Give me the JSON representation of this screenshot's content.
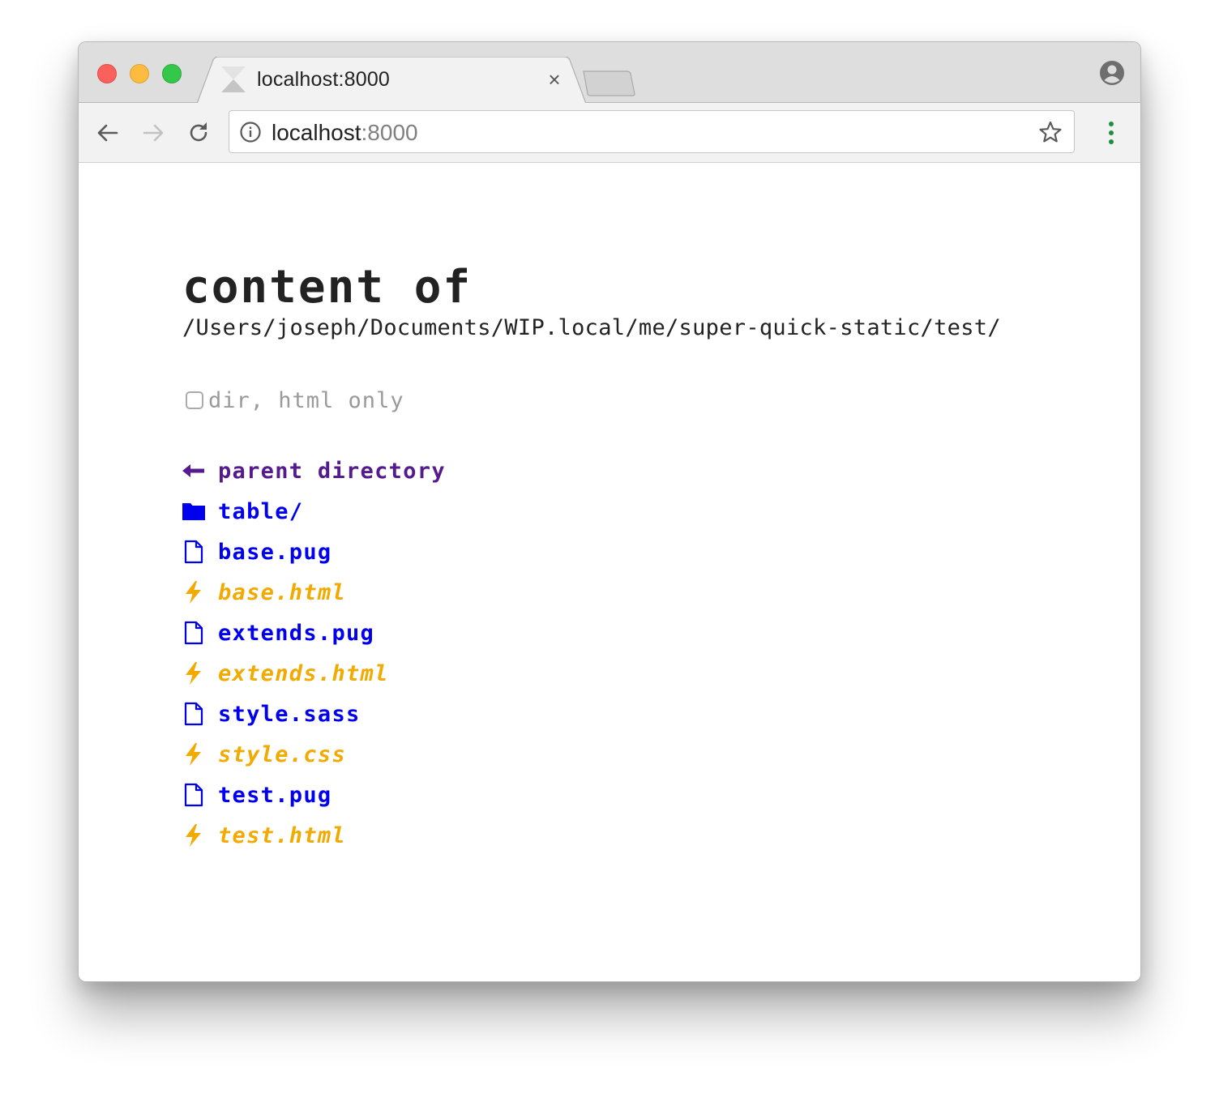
{
  "browser": {
    "tab_title": "localhost:8000",
    "tab_close": "×",
    "url_host": "localhost",
    "url_port": ":8000"
  },
  "page": {
    "heading": "content of",
    "path": "/Users/joseph/Documents/WIP.local/me/super-quick-static/test/",
    "filter_label": "dir, html only",
    "filter_checked": false,
    "entries": [
      {
        "name": "parent directory",
        "kind": "parent",
        "icon": "arrow-left-icon"
      },
      {
        "name": "table/",
        "kind": "directory",
        "icon": "folder-icon"
      },
      {
        "name": "base.pug",
        "kind": "source",
        "icon": "file-icon"
      },
      {
        "name": "base.html",
        "kind": "compiled",
        "icon": "lightning-icon"
      },
      {
        "name": "extends.pug",
        "kind": "source",
        "icon": "file-icon"
      },
      {
        "name": "extends.html",
        "kind": "compiled",
        "icon": "lightning-icon"
      },
      {
        "name": "style.sass",
        "kind": "source",
        "icon": "file-icon"
      },
      {
        "name": "style.css",
        "kind": "compiled",
        "icon": "lightning-icon"
      },
      {
        "name": "test.pug",
        "kind": "source",
        "icon": "file-icon"
      },
      {
        "name": "test.html",
        "kind": "compiled",
        "icon": "lightning-icon"
      }
    ]
  },
  "colors": {
    "parent_link": "#551a8b",
    "link": "#0000ee",
    "compiled": "#f2a900",
    "filter_text": "#9a9a9a"
  }
}
